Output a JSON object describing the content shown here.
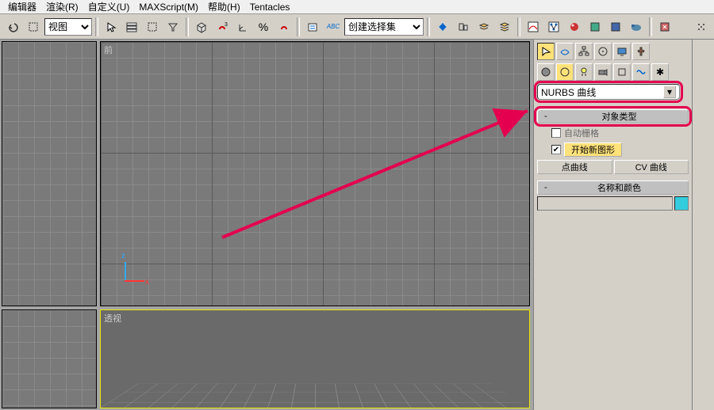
{
  "menu": {
    "items": [
      "编辑器",
      "渲染(R)",
      "自定义(U)",
      "MAXScript(M)",
      "帮助(H)",
      "Tentacles"
    ]
  },
  "toolbar": {
    "view_select": "视图",
    "create_select": "创建选择集"
  },
  "viewports": {
    "front": "前",
    "perspective": "透视",
    "axis": {
      "x": "x",
      "z": "z"
    }
  },
  "panel": {
    "nurbs_dropdown": "NURBS 曲线",
    "rollout_object_type": "对象类型",
    "auto_grid": "自动栅格",
    "start_new_shape": "开始新图形",
    "point_curve": "点曲线",
    "cv_curve": "CV 曲线",
    "rollout_name_color": "名称和颜色"
  }
}
